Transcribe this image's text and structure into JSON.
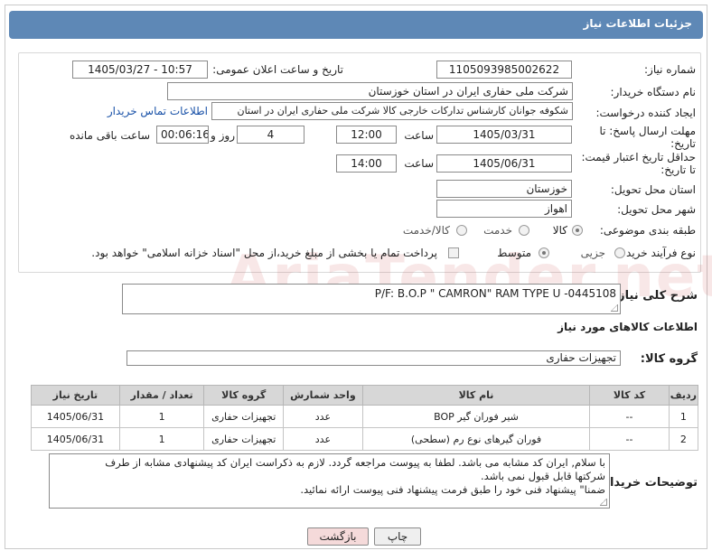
{
  "header": {
    "title": "جزئیات اطلاعات نیاز"
  },
  "form": {
    "need_number_label": "شماره نیاز:",
    "need_number": "1105093985002622",
    "announce_label": "تاریخ و ساعت اعلان عمومی:",
    "announce_value": "1405/03/27 - 10:57",
    "buyer_org_label": "نام دستگاه خریدار:",
    "buyer_org": "شرکت ملی حفاری ایران در استان خوزستان",
    "creator_label": "ایجاد کننده درخواست:",
    "creator": "شکوفه جوانان کارشناس تدارکات خارجی کالا شرکت ملی حفاری ایران در استان",
    "contact_link": "اطلاعات تماس خریدار",
    "deadline_label_1": "مهلت ارسال پاسخ: تا",
    "deadline_label_2": "تاریخ:",
    "deadline_date": "1405/03/31",
    "time_label": "ساعت",
    "deadline_time": "12:00",
    "days_value": "4",
    "days_label": "روز و",
    "remaining_value": "00:06:16",
    "remaining_label": "ساعت باقی مانده",
    "validity_label_1": "حداقل تاریخ اعتبار قیمت:",
    "validity_label_2": "تا تاریخ:",
    "validity_date": "1405/06/31",
    "validity_time": "14:00",
    "province_label": "استان محل تحویل:",
    "province": "خوزستان",
    "city_label": "شهر محل تحویل:",
    "city": "اهواز",
    "category_label": "طبقه بندی موضوعی:",
    "category_options": [
      "کالا",
      "خدمت",
      "کالا/خدمت"
    ],
    "category_selected": "کالا",
    "purchase_label": "نوع فرآیند خرید :",
    "purchase_options": [
      "جزیی",
      "متوسط"
    ],
    "purchase_selected": "متوسط",
    "payment_note": "پرداخت تمام یا بخشی از مبلغ خرید،از محل \"اسناد خزانه اسلامی\" خواهد بود."
  },
  "summary": {
    "label": "شرح کلی نیاز:",
    "value": "P/F: B.O.P \" CAMRON\" RAM TYPE U -0445108"
  },
  "goods_section": {
    "title": "اطلاعات کالاهای مورد نیاز",
    "group_label": "گروه کالا:",
    "group_value": "تجهیزات حفاری"
  },
  "table": {
    "headers": [
      "ردیف",
      "کد کالا",
      "نام کالا",
      "واحد شمارش",
      "گروه کالا",
      "تعداد / مقدار",
      "تاریخ نیاز"
    ],
    "rows": [
      [
        "1",
        "--",
        "شیر فوران گیر BOP",
        "عدد",
        "تجهیزات حفاری",
        "1",
        "1405/06/31"
      ],
      [
        "2",
        "--",
        "فوران گیرهای نوع رم (سطحی)",
        "عدد",
        "تجهیزات حفاری",
        "1",
        "1405/06/31"
      ]
    ]
  },
  "buyer_notes": {
    "label": "توضیحات خریدار:",
    "line1": "با سلام, ایران کد مشابه می باشد. لطفا به پیوست مراجعه گردد. لازم به ذکراست ایران کد پیشنهادی مشابه از طرف",
    "line2": "شرکتها قابل قبول نمی باشد.",
    "line3": "ضمنا\" پیشنهاد فنی خود را طبق فرمت پیشنهاد فنی پیوست ارائه نمائید."
  },
  "buttons": {
    "print": "چاپ",
    "back": "بازگشت"
  },
  "colors": {
    "title_bar": "#5e88b6",
    "back_button_bg": "#f5dada",
    "link": "#1a52a8"
  }
}
